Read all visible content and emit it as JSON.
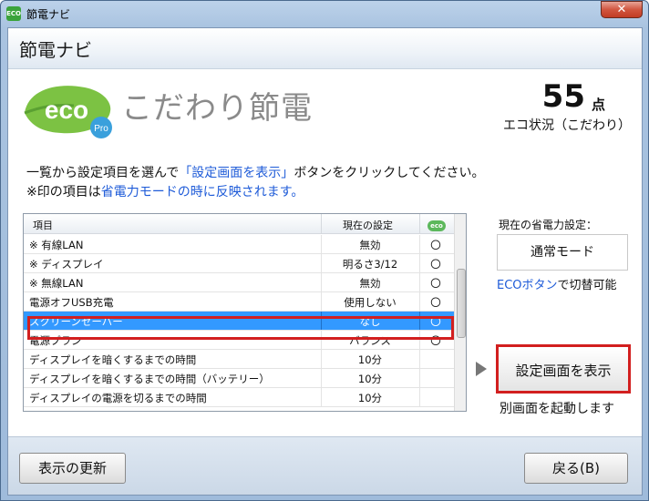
{
  "window": {
    "title": "節電ナビ",
    "app_icon": "ECO",
    "close": "✕"
  },
  "header": {
    "title": "節電ナビ"
  },
  "logo": {
    "eco": "eco",
    "pro": "Pro"
  },
  "subtitle": "こだわり節電",
  "score": {
    "value": "55",
    "unit": "点",
    "label": "エコ状況（こだわり）"
  },
  "instructions": {
    "line1_a": "一覧から設定項目を選んで",
    "line1_link": "「設定画面を表示」",
    "line1_b": "ボタンをクリックしてください。",
    "line2_a": "※印の項目は",
    "line2_link": "省電力モードの時に反映されます。"
  },
  "table": {
    "headers": {
      "item": "項目",
      "current": "現在の設定",
      "eco": "eco"
    },
    "rows": [
      {
        "item": "※ 有線LAN",
        "current": "無効",
        "eco": "〇"
      },
      {
        "item": "※ ディスプレイ",
        "current": "明るさ3/12",
        "eco": "〇"
      },
      {
        "item": "※ 無線LAN",
        "current": "無効",
        "eco": "〇"
      },
      {
        "item": "電源オフUSB充電",
        "current": "使用しない",
        "eco": "〇"
      },
      {
        "item": "スクリーンセーバー",
        "current": "なし",
        "eco": "〇"
      },
      {
        "item": "電源プラン",
        "current": "バランス",
        "eco": "〇"
      },
      {
        "item": "ディスプレイを暗くするまでの時間",
        "current": "10分",
        "eco": ""
      },
      {
        "item": "ディスプレイを暗くするまでの時間（バッテリー）",
        "current": "10分",
        "eco": ""
      },
      {
        "item": "ディスプレイの電源を切るまでの時間",
        "current": "10分",
        "eco": ""
      }
    ],
    "selected_index": 4
  },
  "right_panel": {
    "power_setting_label": "現在の省電力設定：",
    "mode": "通常モード",
    "eco_button_link": "ECOボタン",
    "eco_button_text": "で切替可能",
    "show_settings_button": "設定画面を表示",
    "launch_note": "別画面を起動します"
  },
  "footer": {
    "refresh_button": "表示の更新",
    "back_button": "戻る(B)"
  },
  "colors": {
    "accent_red": "#d21f1f",
    "link_blue": "#1e5bd8",
    "eco_green": "#5cb85c",
    "selection": "#3399ff"
  }
}
